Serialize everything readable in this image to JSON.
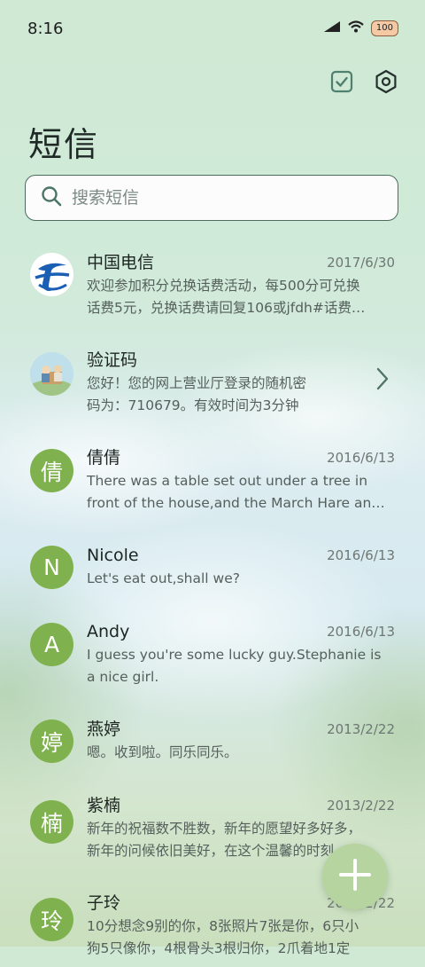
{
  "status": {
    "time": "8:16",
    "battery": "100"
  },
  "page_title": "短信",
  "search": {
    "placeholder": "搜索短信"
  },
  "colors": {
    "accent": "#5d8f7c",
    "avatar_green": "#7fb24f",
    "fab": "#b5d49f"
  },
  "messages": [
    {
      "name": "中国电信",
      "date": "2017/6/30",
      "line1": "欢迎参加积分兑换话费活动，每500分可兑换",
      "line2": "话费5元，兑换话费请回复106或jfdh#话费…",
      "avatar": "telecom-logo"
    },
    {
      "name": "验证码",
      "date": "",
      "line1": "您好！您的网上营业厅登录的随机密",
      "line2": "码为：710679。有效时间为3分钟",
      "avatar": "picture"
    },
    {
      "name": "倩倩",
      "date": "2016/6/13",
      "line1": "There was a table set out under a tree in",
      "line2": "front of the house,and the March Hare an…",
      "avatar": "倩"
    },
    {
      "name": "Nicole",
      "date": "2016/6/13",
      "line1": "Let's eat out,shall we?",
      "line2": "",
      "avatar": "N"
    },
    {
      "name": "Andy",
      "date": "2016/6/13",
      "line1": "I guess you're some lucky guy.Stephanie is",
      "line2": "a nice girl.",
      "avatar": "A"
    },
    {
      "name": "燕婷",
      "date": "2013/2/22",
      "line1": "嗯。收到啦。同乐同乐。",
      "line2": "",
      "avatar": "婷"
    },
    {
      "name": "紫楠",
      "date": "2013/2/22",
      "line1": "新年的祝福数不胜数，新年的愿望好多好多，",
      "line2": "新年的问候依旧美好，在这个温馨的时刻…",
      "avatar": "楠"
    },
    {
      "name": "子玲",
      "date": "2013/2/22",
      "line1": "10分想念9别的你，8张照片7张是你，6只小",
      "line2": "狗5只像你，4根骨头3根归你，2爪着地1定",
      "avatar": "玲"
    }
  ],
  "fab": {
    "label": "+"
  }
}
